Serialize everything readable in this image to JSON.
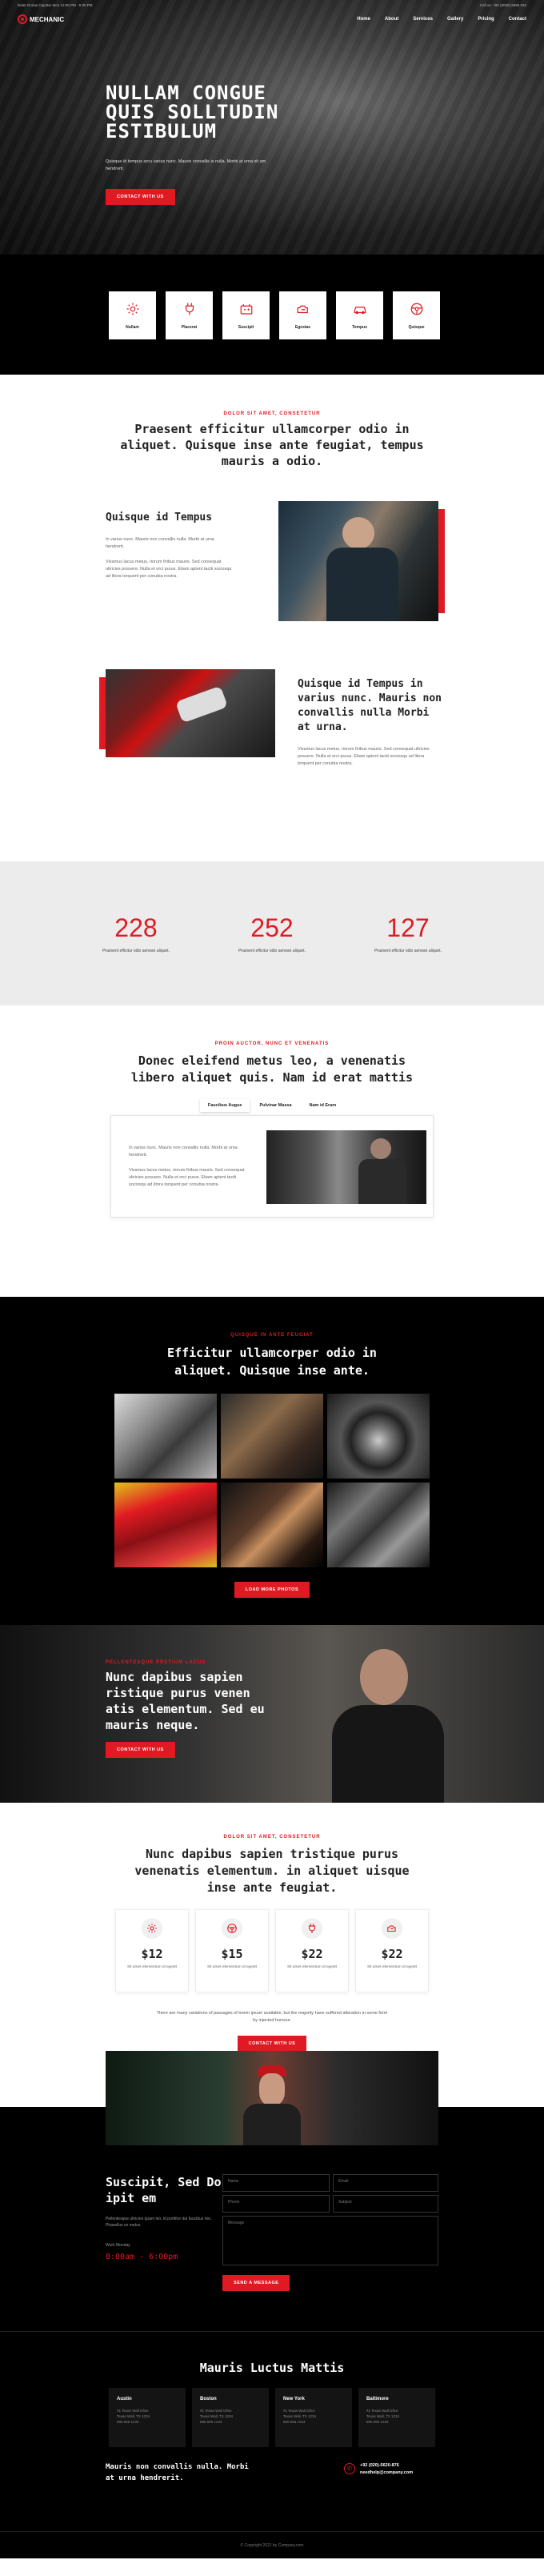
{
  "topbar": {
    "left": "Dalet Grolaa Capstar Mon 12:00 PM - 5:00 PM",
    "right": "Call us: +92 (0020) 5555 034"
  },
  "brand": {
    "name": "MECHANIC"
  },
  "nav": [
    "Home",
    "About",
    "Services",
    "Gallery",
    "Pricing",
    "Contact"
  ],
  "hero": {
    "title": "Nullam congue quis solltudin estibulum",
    "text": "Quisque id tempus arcu varius nunc. Mauris convallis is nulla. Morbi at urna sit am hendrerit.",
    "cta": "Contact With Us"
  },
  "services": [
    "Nullam",
    "Placerat",
    "Suscipit",
    "Egestas",
    "Tempus",
    "Quisque"
  ],
  "about": {
    "kicker": "Dolor sit amet, consetetur",
    "title": "Praesent efficitur ullamcorper odio in aliquet. Quisque inse ante feugiat, tempus mauris a odio.",
    "f1_title": "Quisque id Tempus",
    "f1_p1": "In varius nunc. Mauris non convallis nulla. Morbi at urna hendrerit.",
    "f1_p2": "Vivamus lacus metus, riorum firibus mauris. Sed consequat ultricies posuere. Nulla et orci purus. Etiam aptent taciti sociosqu ad litora torquent per conubia nostra.",
    "f2_title": "Quisque id Tempus in varius nunc. Mauris non convallis nulla Morbi at urna.",
    "f2_p": "Vivamus lacus metus, riorum firibus mauris. Sed consequat ultricies posuere. Nulla et orci purus. Etiam aptent taciti sociosqu ad litora torquent per conubia nostra."
  },
  "stats": [
    {
      "num": "228",
      "label": "Praesent efficitur odio aenean aliquet."
    },
    {
      "num": "252",
      "label": "Praesent efficitur odio aenean aliquet."
    },
    {
      "num": "127",
      "label": "Praesent efficitur odio aenean aliquet."
    }
  ],
  "tabsec": {
    "kicker": "Proin auctor, nunc et venenatis",
    "title": "Donec eleifend metus leo, a venenatis libero aliquet quis. Nam id erat mattis",
    "tabs": [
      "Faucibus Augue",
      "Pulvinar Massa",
      "Nam id Eram"
    ],
    "p1": "In varius nunc. Mauris non convallis nulla. Morbi at urna hendrerit.",
    "p2": "Vivamus lacus metus, riorum firibus mauris. Sed consequat ultricies posuere. Nulla et orci purus. Etiam aptent taciti sociosqu ad litora torquent per conubia nostra."
  },
  "gallery": {
    "kicker": "Quisque in ante feugiat",
    "title": "Efficitur ullamcorper odio in aliquet. Quisque inse ante.",
    "cta": "Load More Photos"
  },
  "mechanic": {
    "kicker": "Pellentesque pretium lacus",
    "title": "Nunc dapibus sapien ristique purus venen atis elementum. Sed eu mauris neque.",
    "cta": "Contact With Us"
  },
  "pricing": {
    "kicker": "Dolor sit amet, consetetur",
    "title": "Nunc dapibus sapien tristique purus venenatis elementum. in aliquet uisque inse ante feugiat.",
    "plans": [
      {
        "amount": "$12",
        "desc": "Sit amet elementum id egestt"
      },
      {
        "amount": "$15",
        "desc": "Sit amet elementum id egestt"
      },
      {
        "amount": "$22",
        "desc": "Sit amet elementum id egestt"
      },
      {
        "amount": "$22",
        "desc": "Sit amet elementum id egestt"
      }
    ],
    "note": "There are many variations of passages of lorem ipsum available, but the majority have suffered alteration in some form by injected humour.",
    "cta": "Contact With Us"
  },
  "contact": {
    "title": "Suscipit, Sed Do ipit em",
    "text": "Pellentesque ultricies quam leo, id porttitor dui faucibus nec. Phasellus ex metus.",
    "hours_label": "Work Monday",
    "hours": "8:00am - 6:00pm",
    "fields": [
      "Name",
      "Email",
      "Phone",
      "Subject",
      "Message"
    ],
    "cta": "Send a Message"
  },
  "locations": {
    "title": "Mauris Luctus Mattis",
    "cities": [
      {
        "city": "Austin",
        "a1": "#1 Texas Wall Ofice",
        "a2": "Texas Wall, TX 1234",
        "a3": "890 555 1234"
      },
      {
        "city": "Boston",
        "a1": "#1 Texas Wall Ofice",
        "a2": "Texas Wall, TX 1234",
        "a3": "890 555 1234"
      },
      {
        "city": "New York",
        "a1": "#1 Texas Wall Ofice",
        "a2": "Texas Wall, TX 1234",
        "a3": "890 555 1234"
      },
      {
        "city": "Baltimore",
        "a1": "#1 Texas Wall Ofice",
        "a2": "Texas Wall, TX 1234",
        "a3": "890 555 1234"
      }
    ],
    "tagline": "Mauris non convallis nulla. Morbi at urna hendrerit.",
    "phone": "+92 (020)-5620-876",
    "email": "needhelp@company.com"
  },
  "footer": {
    "copyright": "© Copyright 2021 by Company.com"
  },
  "colors": {
    "accent": "#e01a22",
    "dark": "#000000",
    "stats_bg": "#ececec"
  }
}
